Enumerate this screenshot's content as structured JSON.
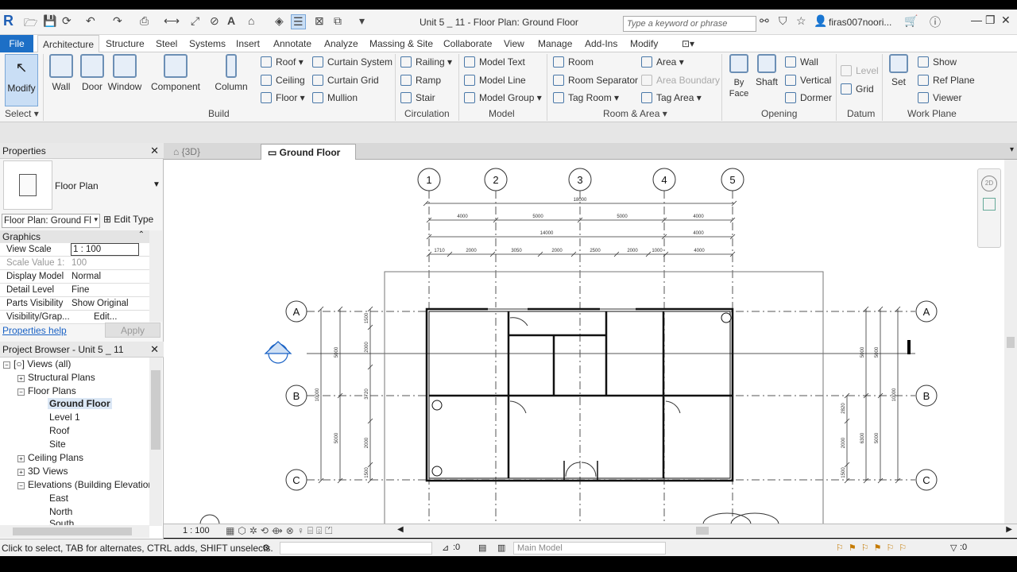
{
  "app": {
    "logo": "R",
    "title": "Unit 5 _ 11 - Floor Plan: Ground Floor",
    "search_placeholder": "Type a keyword or phrase",
    "user": "firas007noori..."
  },
  "tabs": [
    "File",
    "Architecture",
    "Structure",
    "Steel",
    "Systems",
    "Insert",
    "Annotate",
    "Analyze",
    "Massing & Site",
    "Collaborate",
    "View",
    "Manage",
    "Add-Ins",
    "Modify"
  ],
  "ribbon": {
    "modify": "Modify",
    "select": "Select",
    "build": {
      "label": "Build",
      "wall": "Wall",
      "door": "Door",
      "window": "Window",
      "component": "Component",
      "column": "Column",
      "roof": "Roof",
      "ceiling": "Ceiling",
      "floor": "Floor",
      "curtain_system": "Curtain System",
      "curtain_grid": "Curtain Grid",
      "mullion": "Mullion"
    },
    "circulation": {
      "label": "Circulation",
      "railing": "Railing",
      "ramp": "Ramp",
      "stair": "Stair"
    },
    "model": {
      "label": "Model",
      "text": "Model Text",
      "line": "Model Line",
      "group": "Model Group"
    },
    "room_area": {
      "label": "Room & Area",
      "room": "Room",
      "separator": "Room Separator",
      "tag_room": "Tag Room",
      "area": "Area",
      "area_boundary": "Area Boundary",
      "tag_area": "Tag Area"
    },
    "opening": {
      "label": "Opening",
      "by_face": "By Face",
      "shaft": "Shaft",
      "wall": "Wall",
      "vertical": "Vertical",
      "dormer": "Dormer"
    },
    "datum": {
      "label": "Datum",
      "level": "Level",
      "grid": "Grid"
    },
    "work_plane": {
      "label": "Work Plane",
      "set": "Set",
      "show": "Show",
      "ref_plane": "Ref Plane",
      "viewer": "Viewer"
    }
  },
  "properties": {
    "title": "Properties",
    "type_name": "Floor Plan",
    "instance": "Floor Plan: Ground Fl",
    "edit_type": "Edit Type",
    "section": "Graphics",
    "rows": [
      {
        "key": "View Scale",
        "value": "1 : 100"
      },
      {
        "key": "Scale Value    1:",
        "value": "100"
      },
      {
        "key": "Display Model",
        "value": "Normal"
      },
      {
        "key": "Detail Level",
        "value": "Fine"
      },
      {
        "key": "Parts Visibility",
        "value": "Show Original"
      },
      {
        "key": "Visibility/Grap...",
        "value": "Edit..."
      }
    ],
    "help": "Properties help",
    "apply": "Apply"
  },
  "browser": {
    "title": "Project Browser - Unit 5 _ 11",
    "items": [
      "Views (all)",
      "Structural Plans",
      "Floor Plans",
      "Ground Floor",
      "Level 1",
      "Roof",
      "Site",
      "Ceiling Plans",
      "3D Views",
      "Elevations (Building Elevation",
      "East",
      "North",
      "South"
    ]
  },
  "view_tabs": [
    "{3D}",
    "Ground Floor"
  ],
  "drawing": {
    "grid_cols": [
      "1",
      "2",
      "3",
      "4",
      "5"
    ],
    "grid_rows": [
      "A",
      "B",
      "C"
    ],
    "dim_total": "18000",
    "dim_row1": [
      "4000",
      "5000",
      "5000",
      "4000"
    ],
    "dim_row2": [
      "14000",
      "4000"
    ],
    "dim_row3": [
      "1710",
      "2000",
      "3050",
      "2000",
      "2500",
      "2000",
      "1000",
      "4000"
    ],
    "left_dims": [
      "1500",
      "2000",
      "3720",
      "2000",
      "1500"
    ],
    "left_dims2": [
      "5000",
      "5000"
    ],
    "left_total": "10000",
    "right_dims": [
      "2820",
      "2000",
      "1500"
    ],
    "right_dims2": [
      "5000",
      "5000"
    ],
    "right_mid": [
      "5000",
      "6300"
    ],
    "right_total": "10000"
  },
  "view_control": {
    "scale": "1 : 100"
  },
  "status": {
    "text": "Click to select, TAB for alternates, CTRL adds, SHIFT unselects.",
    "zero1": ":0",
    "workset": "Main Model",
    "filter": ":0"
  }
}
